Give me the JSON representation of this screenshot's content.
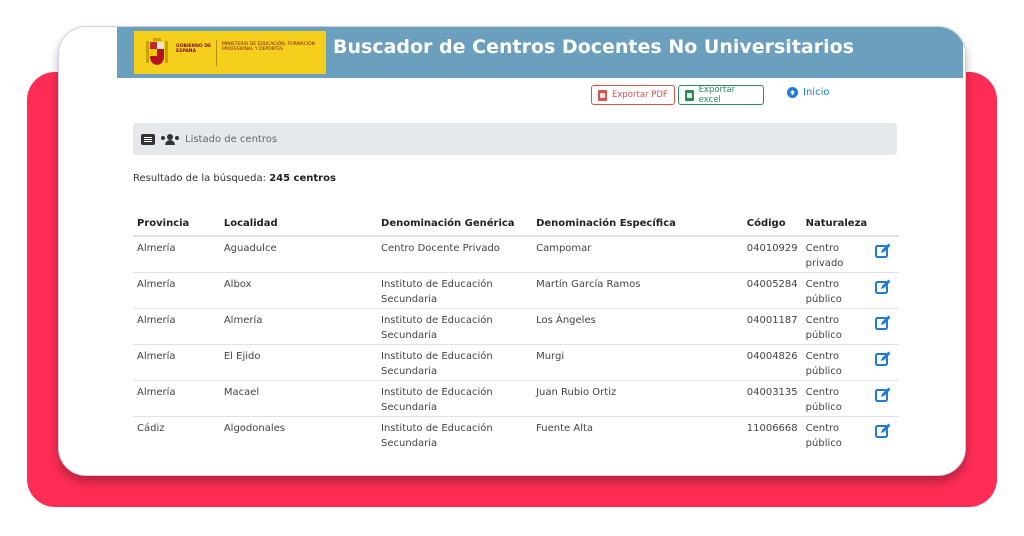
{
  "header": {
    "logo": {
      "gobierno": "GOBIERNO DE ESPAÑA",
      "ministerio": "MINISTERIO DE EDUCACIÓN, FORMACIÓN PROFESIONAL Y DEPORTES"
    },
    "title": "Buscador de Centros Docentes No Universitarios"
  },
  "toolbar": {
    "export_pdf": "Exportar PDF",
    "export_excel": "Exportar excel",
    "home": "Inicio"
  },
  "section": {
    "title": "Listado de centros"
  },
  "result": {
    "label": "Resultado de la búsqueda:",
    "count": "245 centros"
  },
  "table": {
    "columns": [
      "Provincia",
      "Localidad",
      "Denominación Genérica",
      "Denominación Específica",
      "Código",
      "Naturaleza"
    ],
    "rows": [
      [
        "Almería",
        "Aguadulce",
        "Centro Docente Privado",
        "Campomar",
        "04010929",
        "Centro privado"
      ],
      [
        "Almería",
        "Albox",
        "Instituto de Educación Secundaria",
        "Martín García Ramos",
        "04005284",
        "Centro público"
      ],
      [
        "Almería",
        "Almería",
        "Instituto de Educación Secundaria",
        "Los Ángeles",
        "04001187",
        "Centro público"
      ],
      [
        "Almería",
        "El Ejido",
        "Instituto de Educación Secundaria",
        "Murgi",
        "04004826",
        "Centro público"
      ],
      [
        "Almería",
        "Macael",
        "Instituto de Educación Secundaria",
        "Juan Rubio Ortiz",
        "04003135",
        "Centro público"
      ],
      [
        "Cádiz",
        "Algodonales",
        "Instituto de Educación Secundaria",
        "Fuente Alta",
        "11006668",
        "Centro público"
      ]
    ]
  },
  "colors": {
    "accent": "#ff2d55",
    "header": "#6a9fbe",
    "logo": "#f6cf1d",
    "link": "#1f7bd4",
    "pdf": "#d9534f",
    "excel": "#2e8b57"
  },
  "icons": [
    "spain-coat-of-arms-icon",
    "list-icon",
    "users-icon",
    "pdf-file-icon",
    "excel-file-icon",
    "arrow-up-circle-icon",
    "edit-icon"
  ]
}
